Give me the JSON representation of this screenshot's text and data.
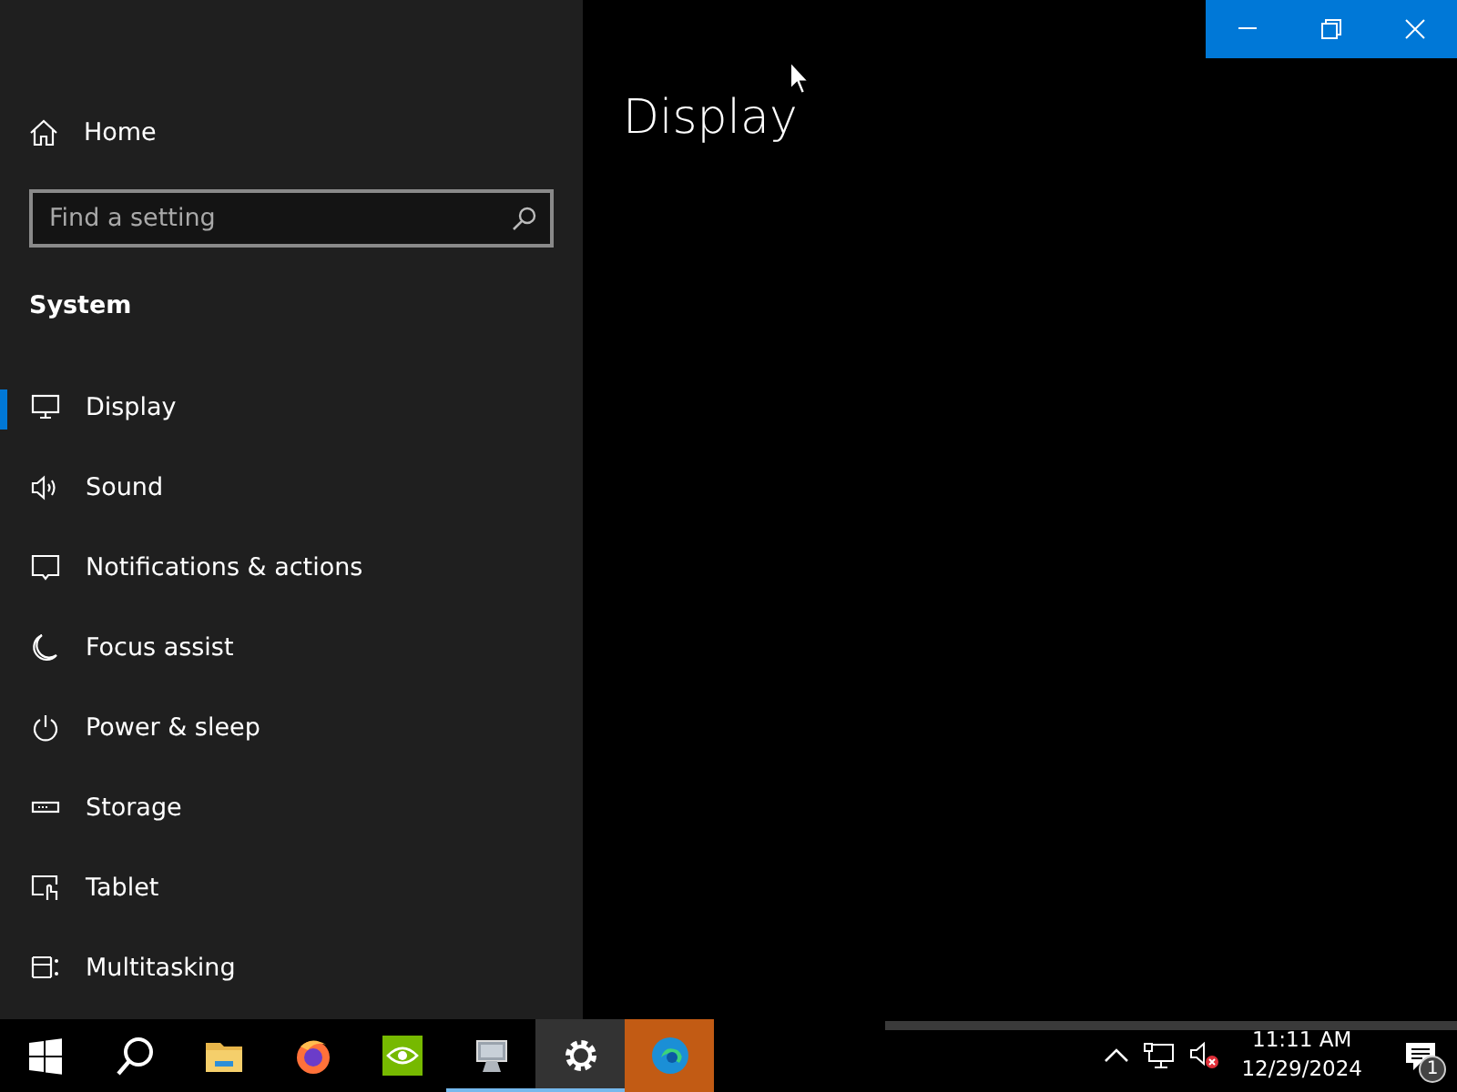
{
  "window": {
    "title": "Display"
  },
  "sidebar": {
    "home": "Home",
    "search": {
      "placeholder": "Find a setting"
    },
    "section": "System",
    "items": [
      {
        "label": "Display",
        "selected": true
      },
      {
        "label": "Sound",
        "selected": false
      },
      {
        "label": "Notifications & actions",
        "selected": false
      },
      {
        "label": "Focus assist",
        "selected": false
      },
      {
        "label": "Power & sleep",
        "selected": false
      },
      {
        "label": "Storage",
        "selected": false
      },
      {
        "label": "Tablet",
        "selected": false
      },
      {
        "label": "Multitasking",
        "selected": false
      }
    ]
  },
  "taskbar": {
    "apps": [
      {
        "running": false,
        "active": false,
        "flashing": false
      },
      {
        "running": false,
        "active": false,
        "flashing": false
      },
      {
        "running": false,
        "active": false,
        "flashing": false
      },
      {
        "running": false,
        "active": false,
        "flashing": false
      },
      {
        "running": false,
        "active": false,
        "flashing": false
      },
      {
        "running": true,
        "active": false,
        "flashing": false
      },
      {
        "running": true,
        "active": true,
        "flashing": false
      },
      {
        "running": false,
        "active": false,
        "flashing": true
      }
    ],
    "time": "11:11 AM",
    "date": "12/29/2024",
    "notification_count": "1"
  }
}
